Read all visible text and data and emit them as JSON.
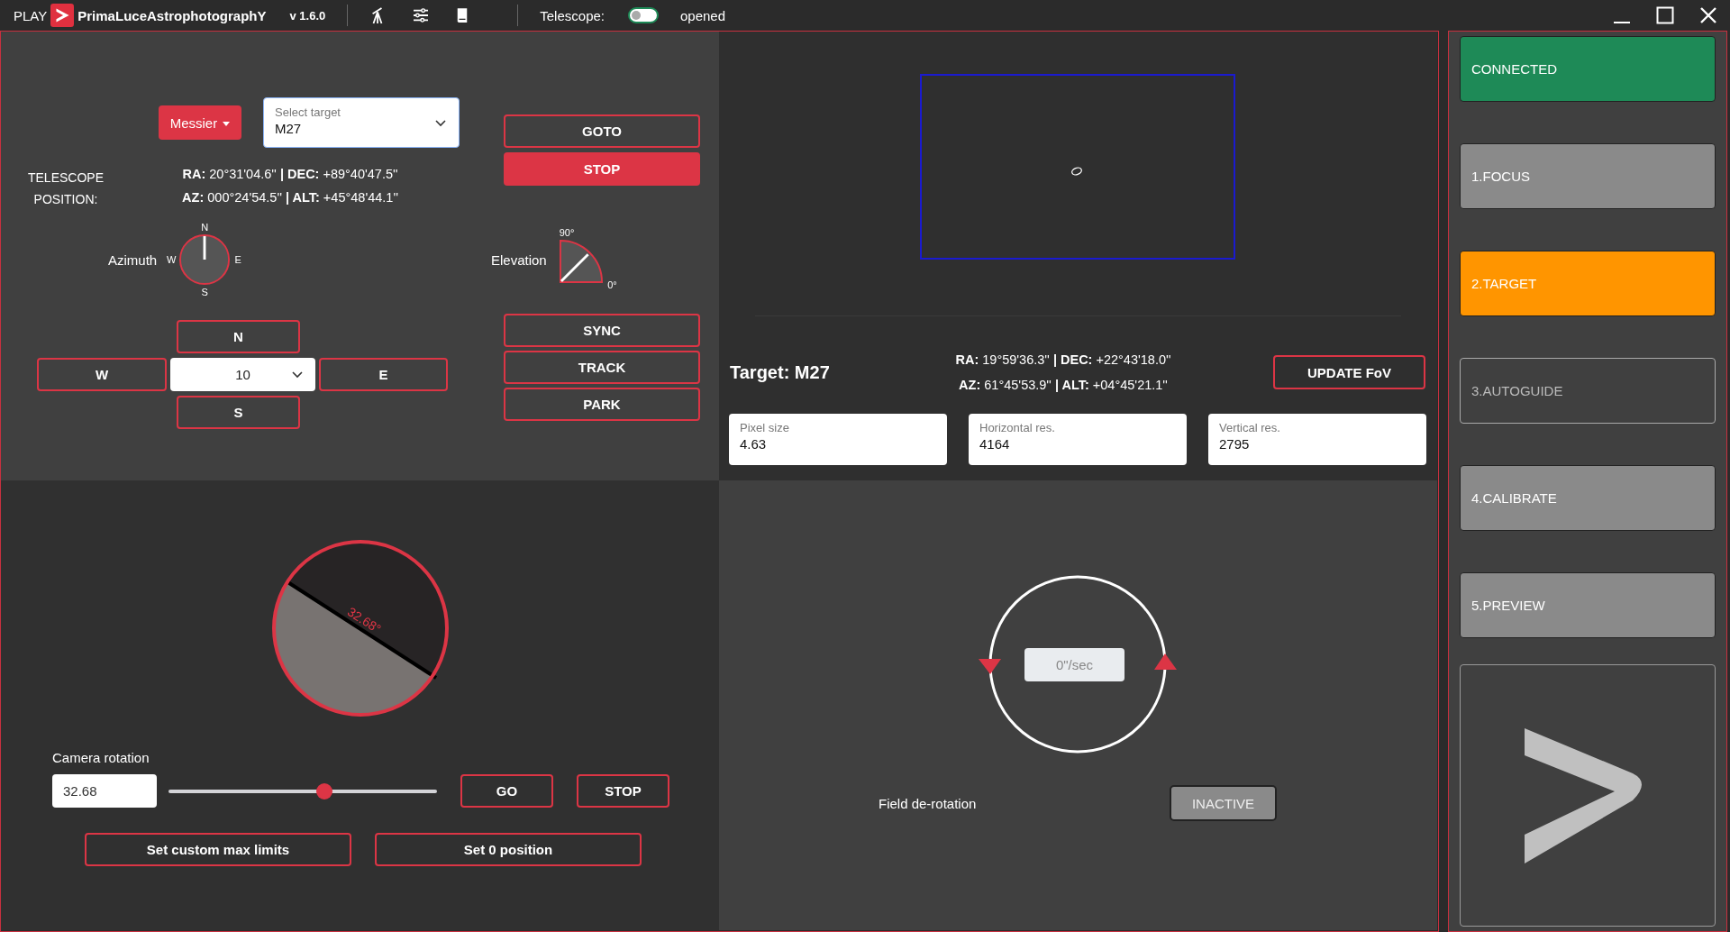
{
  "title_bar": {
    "play_label": "PLAY",
    "app_name": "**P**rima**L**uce**A**strophotograph**Y**",
    "version": "v 1.6.0",
    "telescope_label": "Telescope:",
    "telescope_toggle": {
      "on": false
    },
    "telescope_status": "opened"
  },
  "mount_panel": {
    "catalog_button": "Messier",
    "target_select": {
      "placeholder": "Select target",
      "value": "M27"
    },
    "goto_button": "GOTO",
    "stop_button": "STOP",
    "position_label": "TELESCOPE POSITION:",
    "coordinates": [
      "**RA:** 20°31'04.6'' **| DEC:** +89°40'47.5''",
      "**AZ:** 000°24'54.5'' **| ALT:** +45°48'44.1''"
    ],
    "azimuth": {
      "label": "Azimuth",
      "north": "N",
      "east": "E",
      "south": "S",
      "west": "W"
    },
    "elevation": {
      "label": "Elevation",
      "top": "90°",
      "bottom": "0°"
    },
    "direction_pad": {
      "north": "N",
      "west": "W",
      "east": "E",
      "south": "S",
      "step": "10"
    },
    "action_buttons": [
      "SYNC",
      "TRACK",
      "PARK"
    ]
  },
  "fov_panel": {
    "target_label": "Target: M27",
    "coordinates": [
      "**RA:** 19°59'36.3'' **| DEC:** +22°43'18.0''",
      "**AZ:** 61°45'53.9'' **| ALT:** +04°45'21.1''"
    ],
    "update_button": "UPDATE FoV",
    "fields": [
      {
        "label": "Pixel size",
        "value": "4.63"
      },
      {
        "label": "Horizontal res.",
        "value": "4164"
      },
      {
        "label": "Vertical res.",
        "value": "2795"
      }
    ]
  },
  "rotator_panel": {
    "angle_label": "32.68°",
    "rotation_label": "Camera rotation",
    "rotation_value": "32.68",
    "slider": {
      "level": 0.58
    },
    "go_button": "GO",
    "stop_button": "STOP",
    "limits_button": "Set custom max limits",
    "zero_button": "Set 0 position"
  },
  "derotation_panel": {
    "rate_field": {
      "value": "0\"/sec",
      "disabled": true
    },
    "label": "Field de-rotation",
    "state_button": {
      "label": "INACTIVE",
      "active": false
    }
  },
  "sidebar": {
    "steps": [
      {
        "label": "CONNECTED",
        "kind": "connected"
      },
      {
        "label": "1.FOCUS",
        "kind": "done"
      },
      {
        "label": "2.TARGET",
        "kind": "current"
      },
      {
        "label": "3.AUTOGUIDE",
        "kind": "locked"
      },
      {
        "label": "4.CALIBRATE",
        "kind": "done"
      },
      {
        "label": "5.PREVIEW",
        "kind": "done"
      }
    ]
  }
}
